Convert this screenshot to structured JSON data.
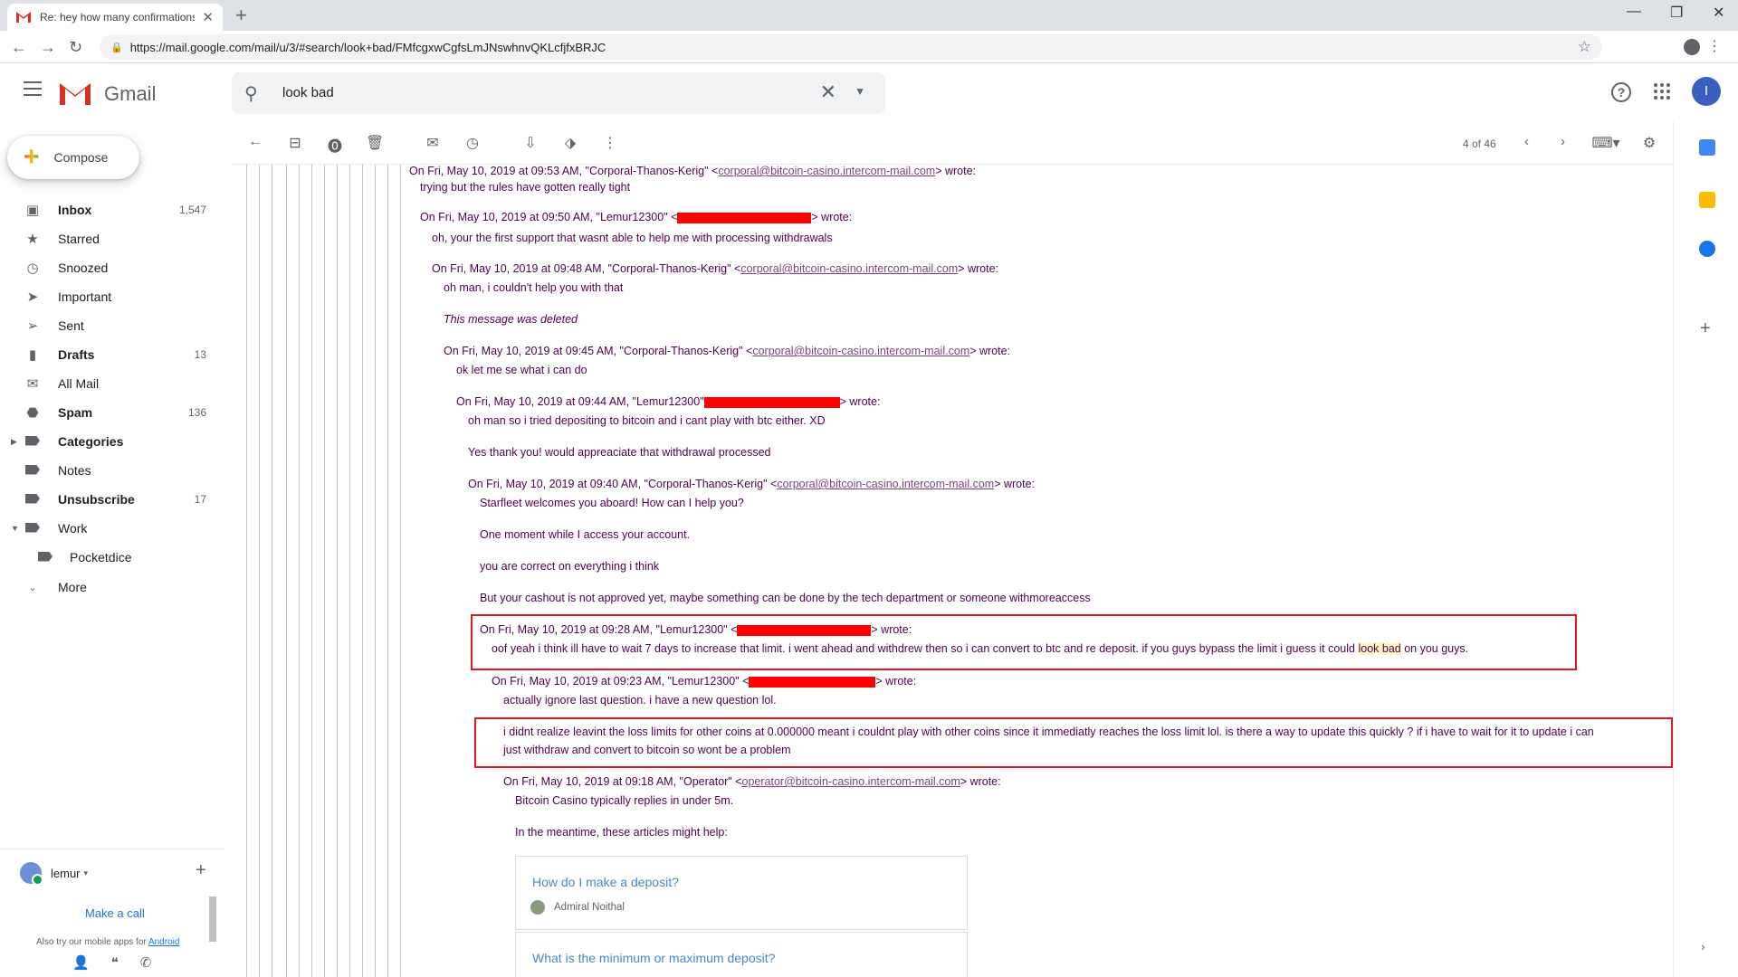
{
  "browser": {
    "tab_title": "Re: hey how many confirmations",
    "url": "https://mail.google.com/mail/u/3/#search/look+bad/FMfcgxwCgfsLmJNswhnvQKLcfjfxBRJC"
  },
  "header": {
    "app_name": "Gmail",
    "search_value": "look bad",
    "avatar_letter": "I"
  },
  "sidebar": {
    "compose_label": "Compose",
    "items": [
      {
        "label": "Inbox",
        "count": "1,547",
        "icon": "inbox-icon"
      },
      {
        "label": "Starred",
        "count": "",
        "icon": "star-icon"
      },
      {
        "label": "Snoozed",
        "count": "",
        "icon": "clock-icon"
      },
      {
        "label": "Important",
        "count": "",
        "icon": "important-icon"
      },
      {
        "label": "Sent",
        "count": "",
        "icon": "send-icon"
      },
      {
        "label": "Drafts",
        "count": "13",
        "icon": "draft-icon"
      },
      {
        "label": "All Mail",
        "count": "",
        "icon": "mail-icon"
      },
      {
        "label": "Spam",
        "count": "136",
        "icon": "spam-icon"
      },
      {
        "label": "Categories",
        "count": "",
        "icon": "label-icon"
      },
      {
        "label": "Notes",
        "count": "",
        "icon": "label-icon"
      },
      {
        "label": "Unsubscribe",
        "count": "17",
        "icon": "label-icon"
      },
      {
        "label": "Work",
        "count": "",
        "icon": "label-icon"
      },
      {
        "label": "Pocketdice",
        "count": "",
        "icon": "label-icon"
      },
      {
        "label": "More",
        "count": "",
        "icon": "chevron-down-icon"
      }
    ],
    "hangouts": {
      "user": "lemur",
      "make_call": "Make a call",
      "also_try": "Also try our mobile apps for",
      "android_link": "Android"
    }
  },
  "toolbar": {
    "page_info": "4 of 46"
  },
  "thread": {
    "lines": [
      {
        "pre": "On Fri, May 10, 2019 at 09:53 AM, \"Corporal-Thanos-Kerig\" <",
        "link": "corporal@bitcoin-casino.intercom-mail.com",
        "post": "> wrote:"
      },
      {
        "text": "trying but the rules have gotten really tight"
      },
      {
        "pre": "On Fri, May 10, 2019 at 09:50 AM, \"Lemur12300\" <",
        "post": "> wrote:"
      },
      {
        "text": "oh, your the first support that wasnt able to help me with processing withdrawals"
      },
      {
        "pre": "On Fri, May 10, 2019 at 09:48 AM, \"Corporal-Thanos-Kerig\" <",
        "link": "corporal@bitcoin-casino.intercom-mail.com",
        "post": "> wrote:"
      },
      {
        "text": "oh man, i couldn't help you with that"
      },
      {
        "text": "This message was deleted"
      },
      {
        "pre": "On Fri, May 10, 2019 at 09:45 AM, \"Corporal-Thanos-Kerig\" <",
        "link": "corporal@bitcoin-casino.intercom-mail.com",
        "post": "> wrote:"
      },
      {
        "text": "ok let me se what i can do"
      },
      {
        "pre": "On Fri, May 10, 2019 at 09:44 AM, \"Lemur12300\"",
        "post": "> wrote:"
      },
      {
        "text": "oh man so i tried depositing to bitcoin and i cant play with btc either. XD"
      },
      {
        "text": "Yes thank you! would appreaciate that withdrawal processed"
      },
      {
        "pre": "On Fri, May 10, 2019 at 09:40 AM, \"Corporal-Thanos-Kerig\" <",
        "link": "corporal@bitcoin-casino.intercom-mail.com",
        "post": "> wrote:"
      },
      {
        "text": "Starfleet welcomes you aboard! How can I help you?"
      },
      {
        "text": "One moment while I access your account."
      },
      {
        "text": "you are correct on everything i think"
      },
      {
        "text": "But your cashout is not approved yet, maybe something can be done by the tech department or someone withmoreaccess"
      },
      {
        "pre": "On Fri, May 10, 2019 at 09:28 AM, \"Lemur12300\" <",
        "post": "> wrote:"
      },
      {
        "pre": "oof yeah i think ill have to wait 7 days to increase that limit. i went ahead and withdrew then so i can convert to btc and re deposit. if you guys bypass the limit i guess it could ",
        "highlight": "look bad",
        "post": " on you guys."
      },
      {
        "pre": "On Fri, May 10, 2019 at 09:23 AM, \"Lemur12300\" <",
        "post": "> wrote:"
      },
      {
        "text": "actually ignore last question. i have a new question lol."
      },
      {
        "text": "i didnt realize leavint the loss limits for other coins at 0.000000 meant i couldnt play with other coins since it immediatly reaches the loss limit lol. is there a way to update this quickly ? if i have to wait for it to update i can"
      },
      {
        "text": "just withdraw and convert to bitcoin so wont be a problem"
      },
      {
        "pre": "On Fri, May 10, 2019 at 09:18 AM, \"Operator\" <",
        "link": "operator@bitcoin-casino.intercom-mail.com",
        "post": "> wrote:"
      },
      {
        "text": "Bitcoin Casino typically replies in under 5m."
      },
      {
        "text": "In the meantime, these articles might help:"
      }
    ],
    "articles": [
      {
        "title": "How do I make a deposit?",
        "author": "Admiral Noithal"
      },
      {
        "title": "What is the minimum or maximum deposit?",
        "author": ""
      }
    ]
  },
  "colors": {
    "quote_text": "#500050",
    "annotation_box": "#e0181f",
    "redaction": "#ff0000",
    "article_link": "#4a86c8"
  }
}
